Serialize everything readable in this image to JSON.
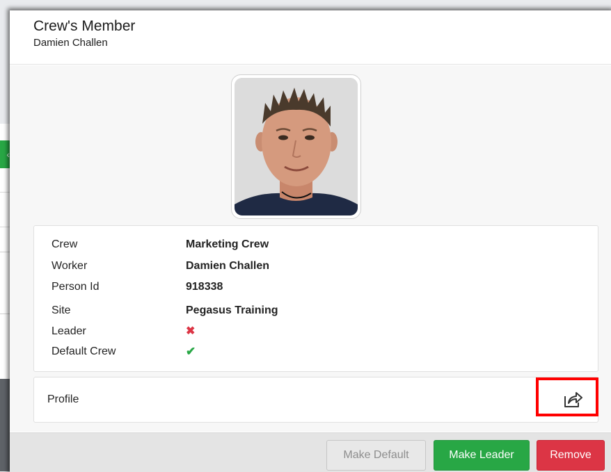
{
  "modal": {
    "title": "Crew's Member",
    "subtitle": "Damien Challen"
  },
  "details": [
    {
      "label": "Crew",
      "value": "Marketing Crew"
    },
    {
      "label": "Worker",
      "value": "Damien Challen"
    },
    {
      "label": "Person Id",
      "value": "918338"
    },
    {
      "label": "Site",
      "value": "Pegasus Training"
    },
    {
      "label": "Leader",
      "icon": "x-icon",
      "status": false
    },
    {
      "label": "Default Crew",
      "icon": "check-icon",
      "status": true
    }
  ],
  "profile": {
    "label": "Profile",
    "action_icon": "share-icon"
  },
  "footer": {
    "make_default_label": "Make Default",
    "make_leader_label": "Make Leader",
    "remove_label": "Remove"
  },
  "colors": {
    "success": "#28a745",
    "danger": "#dc3545",
    "highlight": "#ff0000"
  }
}
